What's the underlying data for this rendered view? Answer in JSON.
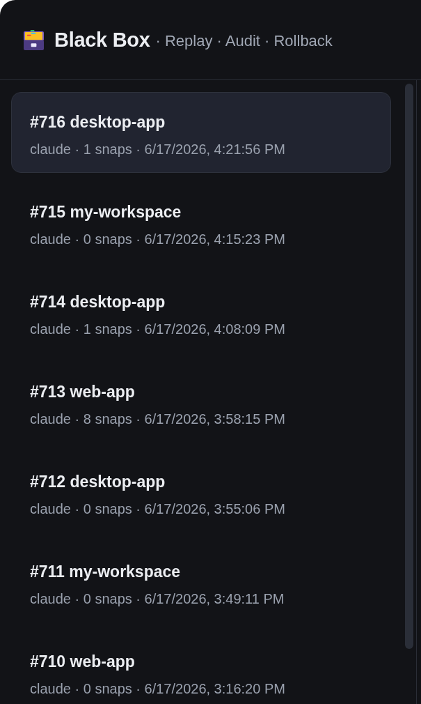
{
  "header": {
    "title": "Black Box",
    "subtitle": "· Replay · Audit · Rollback"
  },
  "sessions": [
    {
      "title": "#716 desktop-app",
      "meta": "claude · 1 snaps · 6/17/2026, 4:21:56 PM",
      "selected": true
    },
    {
      "title": "#715 my-workspace",
      "meta": "claude · 0 snaps · 6/17/2026, 4:15:23 PM",
      "selected": false
    },
    {
      "title": "#714 desktop-app",
      "meta": "claude · 1 snaps · 6/17/2026, 4:08:09 PM",
      "selected": false
    },
    {
      "title": "#713 web-app",
      "meta": "claude · 8 snaps · 6/17/2026, 3:58:15 PM",
      "selected": false
    },
    {
      "title": "#712 desktop-app",
      "meta": "claude · 0 snaps · 6/17/2026, 3:55:06 PM",
      "selected": false
    },
    {
      "title": "#711 my-workspace",
      "meta": "claude · 0 snaps · 6/17/2026, 3:49:11 PM",
      "selected": false
    },
    {
      "title": "#710 web-app",
      "meta": "claude · 0 snaps · 6/17/2026, 3:16:20 PM",
      "selected": false
    }
  ]
}
